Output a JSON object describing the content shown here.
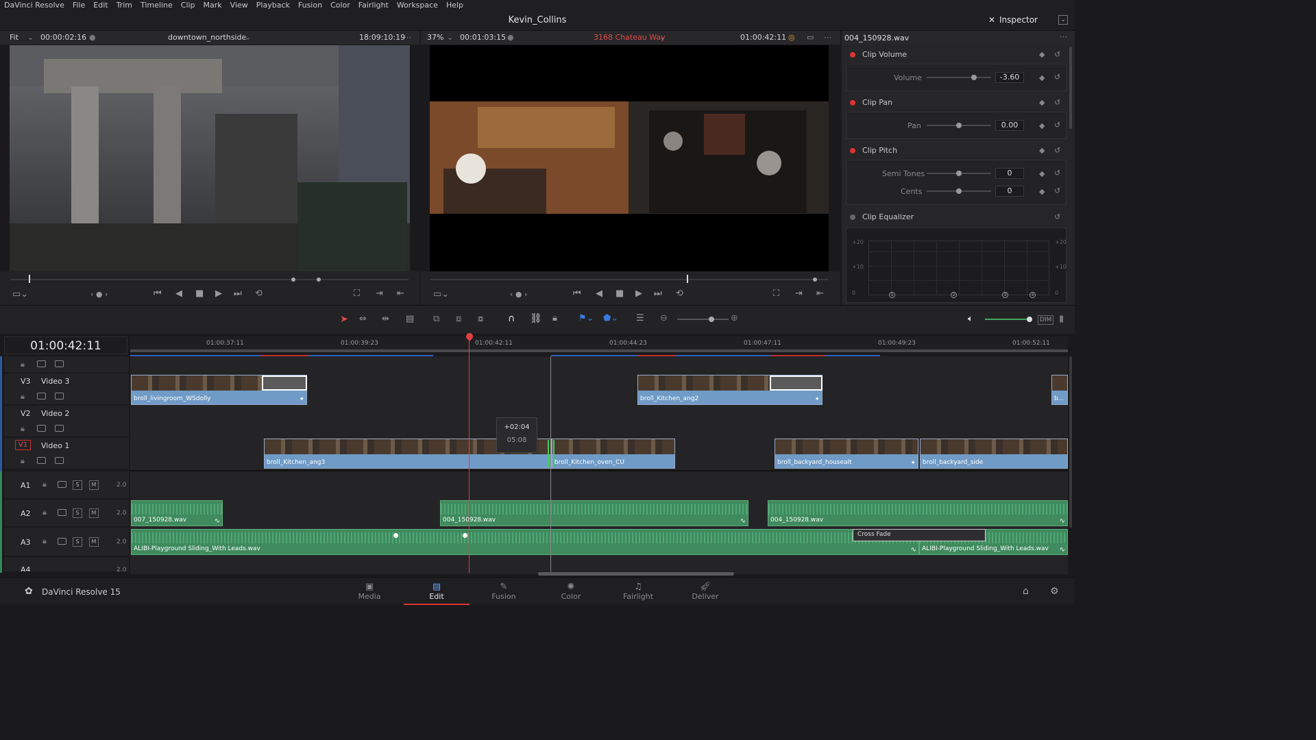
{
  "menu": {
    "items": [
      "DaVinci Resolve",
      "File",
      "Edit",
      "Trim",
      "Timeline",
      "Clip",
      "Mark",
      "View",
      "Playback",
      "Fusion",
      "Color",
      "Fairlight",
      "Workspace",
      "Help"
    ]
  },
  "project": {
    "title": "Kevin_Collins"
  },
  "inspector": {
    "label": "Inspector",
    "clip_name": "004_150928.wav",
    "clip_volume": "Clip Volume",
    "volume_label": "Volume",
    "volume_value": "-3.60",
    "clip_pan": "Clip Pan",
    "pan_label": "Pan",
    "pan_value": "0.00",
    "clip_pitch": "Clip Pitch",
    "semitones_label": "Semi Tones",
    "semitones_value": "0",
    "cents_label": "Cents",
    "cents_value": "0",
    "clip_eq": "Clip Equalizer",
    "eq_labels": {
      "top": "+20",
      "mid": "+10",
      "bottom": "0"
    }
  },
  "source_viewer": {
    "zoom": "Fit",
    "timecode": "00:00:02:16",
    "clip": "downtown_northside",
    "tc_right": "18:09:10:19"
  },
  "timeline_viewer": {
    "zoom": "37%",
    "timecode": "00:01:03:15",
    "clip": "3168 Chateau Way",
    "tc_right": "01:00:42:11"
  },
  "timeline": {
    "current_tc": "01:00:42:11",
    "ruler": [
      "01:00:37:11",
      "01:00:39:23",
      "01:00:42:11",
      "01:00:44:23",
      "01:00:47:11",
      "01:00:49:23",
      "01:00:52:11"
    ],
    "tracks": {
      "v3": {
        "id": "V3",
        "name": "Video 3"
      },
      "v2": {
        "id": "V2",
        "name": "Video 2"
      },
      "v1": {
        "id": "V1",
        "name": "Video 1"
      },
      "a1": {
        "id": "A1",
        "level": "2.0"
      },
      "a2": {
        "id": "A2",
        "level": "2.0"
      },
      "a3": {
        "id": "A3",
        "level": "2.0"
      },
      "a4": {
        "id": "A4",
        "level": "2.0"
      }
    },
    "clips": {
      "v3_1": "broll_livingroom_WSdolly",
      "v3_2": "broll_Kitchen_ang2",
      "v3_3": "b...",
      "v1_1": "broll_Kitchen_ang3",
      "v1_2": "broll_Kitchen_oven_CU",
      "v1_3": "broll_backyard_housealt",
      "v1_4": "broll_backyard_side",
      "a2_1": "007_150928.wav",
      "a2_2": "004_150928.wav",
      "a2_3": "004_150928.wav",
      "a3_1": "ALIBI-Playground Sliding_With Leads.wav",
      "a3_2": "ALIBI-Playground Sliding_With Leads.wav",
      "crossfade": "Cross Fade"
    },
    "trim_tooltip": {
      "offset": "+02:04",
      "duration": "05:08"
    }
  },
  "footer": {
    "app": "DaVinci Resolve 15",
    "pages": [
      {
        "label": "Media",
        "icon": "media-icon"
      },
      {
        "label": "Edit",
        "icon": "edit-icon"
      },
      {
        "label": "Fusion",
        "icon": "fusion-icon"
      },
      {
        "label": "Color",
        "icon": "color-icon"
      },
      {
        "label": "Fairlight",
        "icon": "fairlight-icon"
      },
      {
        "label": "Deliver",
        "icon": "deliver-icon"
      }
    ],
    "active": "Edit"
  },
  "colors": {
    "accent_red": "#d33333",
    "video_clip": "#6f9bc6",
    "audio_clip": "#3f8a5e",
    "bg": "#1a1a1c"
  }
}
